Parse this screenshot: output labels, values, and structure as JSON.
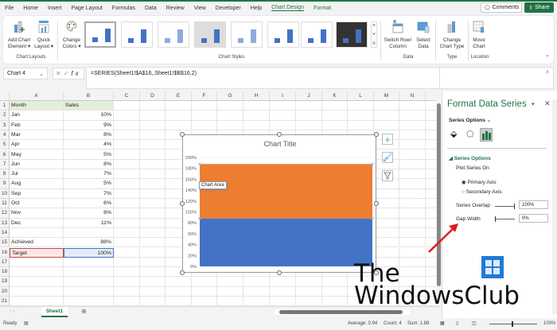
{
  "ribbon": {
    "tabs": [
      "File",
      "Home",
      "Insert",
      "Page Layout",
      "Formulas",
      "Data",
      "Review",
      "View",
      "Developer",
      "Help",
      "Chart Design",
      "Format"
    ],
    "active_tab": "Chart Design",
    "comments": "Comments",
    "share": "Share",
    "add_chart_element": [
      "Add Chart",
      "Element ▾"
    ],
    "quick_layout": [
      "Quick",
      "Layout ▾"
    ],
    "group_chart_layouts": "Chart Layouts",
    "change_colors": [
      "Change",
      "Colors ▾"
    ],
    "group_chart_styles": "Chart Styles",
    "switch_row_column": [
      "Switch Row/",
      "Column"
    ],
    "select_data": [
      "Select",
      "Data"
    ],
    "group_data": "Data",
    "change_chart_type": [
      "Change",
      "Chart Type"
    ],
    "group_type": "Type",
    "move_chart": [
      "Move",
      "Chart"
    ],
    "group_location": "Location"
  },
  "formula_bar": {
    "name_box": "Chart 4",
    "formula": "=SERIES(Sheet1!$A$16,,Sheet1!$B$16,2)",
    "fx": "fx"
  },
  "sheet": {
    "columns": [
      "A",
      "B",
      "C",
      "D",
      "E",
      "F",
      "G",
      "H",
      "I",
      "J",
      "K",
      "L",
      "M",
      "N",
      "O"
    ],
    "rows": [
      [
        "Month",
        "Sales"
      ],
      [
        "Jan",
        "10%"
      ],
      [
        "Feb",
        "9%"
      ],
      [
        "Mar",
        "8%"
      ],
      [
        "Apr",
        "4%"
      ],
      [
        "May",
        "5%"
      ],
      [
        "Jun",
        "8%"
      ],
      [
        "Jul",
        "7%"
      ],
      [
        "Aug",
        "5%"
      ],
      [
        "Sep",
        "7%"
      ],
      [
        "Oct",
        "6%"
      ],
      [
        "Nov",
        "8%"
      ],
      [
        "Dec",
        "11%"
      ],
      [
        "",
        ""
      ],
      [
        "Achieved",
        "88%"
      ],
      [
        "Target",
        "100%"
      ],
      [
        "",
        ""
      ],
      [
        "",
        ""
      ],
      [
        "",
        ""
      ],
      [
        "",
        ""
      ],
      [
        "",
        ""
      ]
    ],
    "tab": "Sheet1"
  },
  "chart_data": {
    "type": "bar",
    "stacked": true,
    "title": "Chart Title",
    "categories": [
      ""
    ],
    "series": [
      {
        "values": [
          0.88
        ],
        "color": "#4472c4"
      },
      {
        "values": [
          1.0
        ],
        "color": "#ed7d31"
      }
    ],
    "ylim": [
      0,
      2
    ],
    "yticks": [
      "0%",
      "20%",
      "40%",
      "60%",
      "80%",
      "100%",
      "120%",
      "140%",
      "160%",
      "180%",
      "200%"
    ],
    "tooltip": "Chart Area",
    "grid": true
  },
  "pane": {
    "title": "Format Data Series",
    "series_options_dropdown": "Series Options",
    "section": "Series Options",
    "plot_series_on": "Plot Series On",
    "primary_axis": "Primary Axis",
    "secondary_axis": "Secondary Axis",
    "series_overlap_label": "Series Overlap",
    "series_overlap_value": "100%",
    "gap_width_label": "Gap Width",
    "gap_width_value": "0%",
    "accent": "#217346"
  },
  "status": {
    "ready": "Ready",
    "average": "Average: 0.94",
    "count": "Count: 4",
    "sum": "Sum: 1.88",
    "zoom": "100%"
  },
  "watermark": [
    "The",
    "WindowsClub"
  ]
}
